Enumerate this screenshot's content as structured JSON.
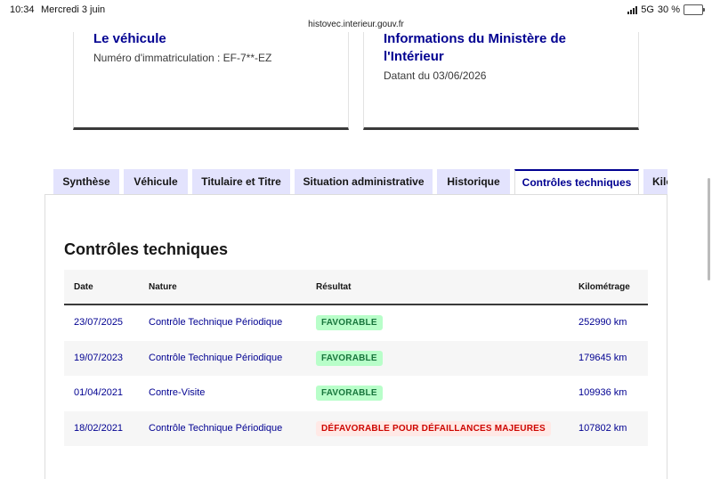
{
  "status_bar": {
    "time": "10:34",
    "date": "Mercredi 3 juin",
    "network": "5G",
    "battery": "30 %",
    "battery_level": 0.3,
    "url": "histovec.interieur.gouv.fr"
  },
  "cards": [
    {
      "title": "Le véhicule",
      "subtitle": "Numéro d'immatriculation : EF-7**-EZ"
    },
    {
      "title": "Informations du Ministère de l'Intérieur",
      "subtitle": "Datant du 03/06/2026"
    }
  ],
  "tabs": [
    {
      "label": "Synthèse"
    },
    {
      "label": "Véhicule"
    },
    {
      "label": "Titulaire et Titre"
    },
    {
      "label": "Situation administrative"
    },
    {
      "label": "Historique"
    },
    {
      "label": "Contrôles techniques"
    },
    {
      "label": "Kilométrage"
    }
  ],
  "active_tab": "Contrôles techniques",
  "section": {
    "title": "Contrôles techniques"
  },
  "table": {
    "headers": {
      "date": "Date",
      "nature": "Nature",
      "result": "Résultat",
      "mileage": "Kilométrage"
    },
    "rows": [
      {
        "date": "23/07/2025",
        "nature": "Contrôle Technique Périodique",
        "result": "FAVORABLE",
        "status": "ok",
        "mileage": "252990 km"
      },
      {
        "date": "19/07/2023",
        "nature": "Contrôle Technique Périodique",
        "result": "FAVORABLE",
        "status": "ok",
        "mileage": "179645 km"
      },
      {
        "date": "01/04/2021",
        "nature": "Contre-Visite",
        "result": "FAVORABLE",
        "status": "ok",
        "mileage": "109936 km"
      },
      {
        "date": "18/02/2021",
        "nature": "Contrôle Technique Périodique",
        "result": "DÉFAVORABLE POUR DÉFAILLANCES MAJEURES",
        "status": "ko",
        "mileage": "107802 km"
      }
    ]
  },
  "colors": {
    "primary_blue": "#000091",
    "tab_bg": "#e3e3fd",
    "ok_bg": "#b8fec9",
    "ok_text": "#18753c",
    "ko_bg": "#ffe9e6",
    "ko_text": "#ce0500"
  }
}
